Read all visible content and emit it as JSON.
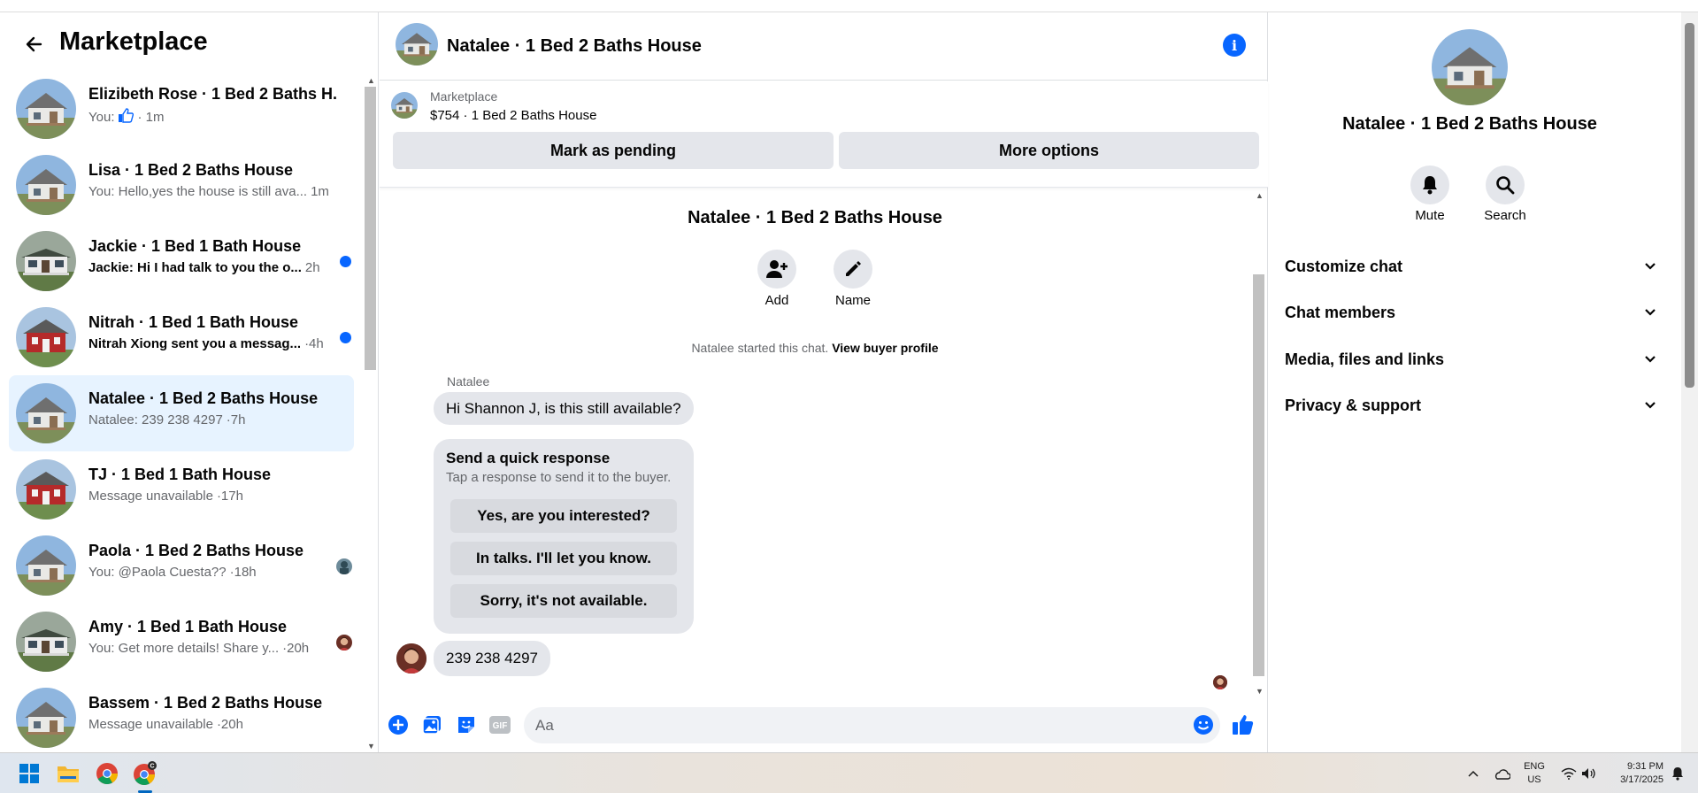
{
  "colors": {
    "accent": "#0866ff",
    "active_row": "#e7f3ff",
    "bubble": "#e4e6eb",
    "muted_text": "#65676b"
  },
  "sidebar": {
    "title": "Marketplace",
    "back_icon": "arrow-left-icon",
    "conversations": [
      {
        "title": "Elizibeth Rose · 1 Bed 2 Baths H...",
        "sender": "You:",
        "preview": "",
        "time": "· 1m",
        "has_like": true,
        "unread": false,
        "house": "white"
      },
      {
        "title": "Lisa · 1 Bed 2 Baths House",
        "sender": "",
        "preview": "You: Hello,yes the house is still ava...",
        "time": "1m",
        "unread": false,
        "house": "white"
      },
      {
        "title": "Jackie · 1 Bed 1 Bath House",
        "sender": "",
        "preview": "Jackie: Hi I had talk to you the o...",
        "time": "2h",
        "unread": true,
        "house": "porch"
      },
      {
        "title": "Nitrah · 1 Bed 1 Bath House",
        "sender": "",
        "preview": "Nitrah Xiong sent you a messag...",
        "time": "·4h",
        "unread": true,
        "house": "red"
      },
      {
        "title": "Natalee · 1 Bed 2 Baths House",
        "sender": "",
        "preview": "Natalee: 239 238 4297",
        "time": "·7h",
        "unread": false,
        "active": true,
        "house": "white"
      },
      {
        "title": "TJ · 1 Bed 1 Bath House",
        "sender": "",
        "preview": "Message unavailable",
        "time": "·17h",
        "unread": false,
        "house": "red"
      },
      {
        "title": "Paola · 1 Bed 2 Baths House",
        "sender": "",
        "preview": "You: @Paola Cuesta??",
        "time": "·18h",
        "unread": false,
        "house": "white"
      },
      {
        "title": "Amy · 1 Bed 1 Bath House",
        "sender": "",
        "preview": "You: Get more details! Share y...",
        "time": "·20h",
        "unread": false,
        "house": "porch"
      },
      {
        "title": "Bassem · 1 Bed 2 Baths House",
        "sender": "",
        "preview": "Message unavailable",
        "time": "·20h",
        "unread": false,
        "house": "white"
      }
    ]
  },
  "chat": {
    "header_title": "Natalee · 1 Bed 2 Baths House",
    "info_icon": "info-icon",
    "marketplace_label": "Marketplace",
    "listing": "$754 · 1 Bed 2 Baths House",
    "mark_pending_label": "Mark as pending",
    "more_options_label": "More options",
    "conversation_title": "Natalee · 1 Bed 2 Baths House",
    "add_label": "Add",
    "name_label": "Name",
    "started_text": "Natalee started this chat.",
    "view_profile_label": "View buyer profile",
    "sender_name": "Natalee",
    "first_message": "Hi Shannon J, is this still available?",
    "quick_response_title": "Send a quick response",
    "quick_response_sub": "Tap a response to send it to the buyer.",
    "quick_responses": [
      "Yes, are you interested?",
      "In talks. I'll let you know.",
      "Sorry, it's not available."
    ],
    "phone_message": "239 238 4297",
    "composer_placeholder": "Aa",
    "composer_icons": [
      "plus-icon",
      "photo-icon",
      "sticker-icon",
      "gif-icon",
      "emoji-icon",
      "thumbs-up-icon"
    ]
  },
  "details": {
    "name": "Natalee · 1 Bed 2 Baths House",
    "mute_label": "Mute",
    "search_label": "Search",
    "sections": [
      "Customize chat",
      "Chat members",
      "Media, files and links",
      "Privacy & support"
    ]
  },
  "taskbar": {
    "lang_top": "ENG",
    "lang_bottom": "US",
    "time": "9:31 PM",
    "date": "3/17/2025"
  }
}
